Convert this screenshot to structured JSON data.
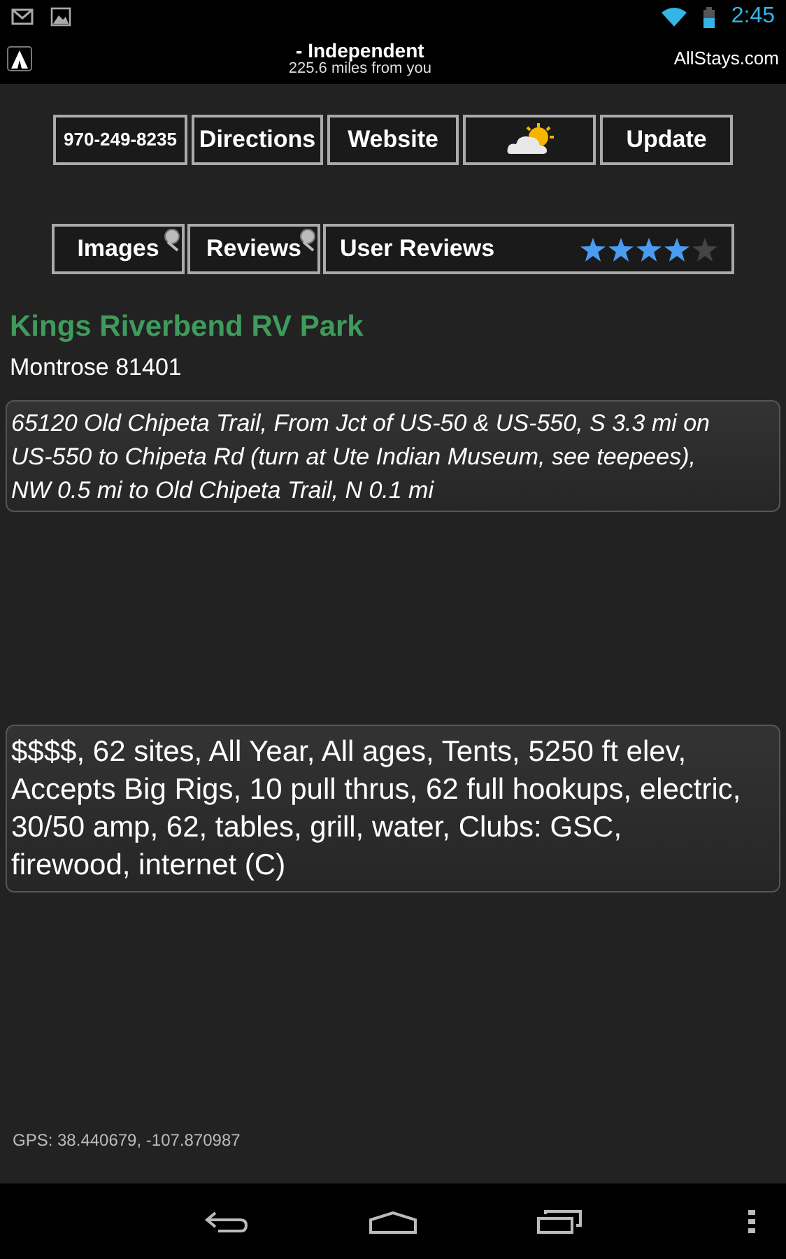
{
  "status_bar": {
    "time": "2:45"
  },
  "action_bar": {
    "title": "- Independent",
    "subtitle": "225.6 miles from you",
    "site": "AllStays.com"
  },
  "buttons": [
    {
      "kind": "text",
      "label": "970-249-8235"
    },
    {
      "kind": "text",
      "label": "Directions"
    },
    {
      "kind": "text",
      "label": "Website"
    },
    {
      "kind": "weather"
    },
    {
      "kind": "text",
      "label": "Update"
    }
  ],
  "search_buttons": [
    {
      "label": "Images"
    },
    {
      "label": "Reviews"
    }
  ],
  "user_reviews": {
    "label": "User Reviews",
    "stars": 4
  },
  "park": {
    "name": "Kings Riverbend RV Park",
    "city": "Montrose 81401"
  },
  "directions": "65120 Old Chipeta Trail, From Jct of US-50 & US-550, S 3.3 mi on US-550 to Chipeta Rd (turn at Ute Indian Museum, see teepees), NW 0.5 mi to Old Chipeta Trail, N 0.1 mi",
  "details": "$$$$, 62 sites, All Year, All ages, Tents, 5250 ft elev, Accepts Big Rigs, 10 pull thrus, 62 full hookups, electric, 30/50 amp, 62, tables, grill, water, Clubs: GSC, firewood, internet (C)",
  "gps": "GPS: 38.440679, -107.870987"
}
